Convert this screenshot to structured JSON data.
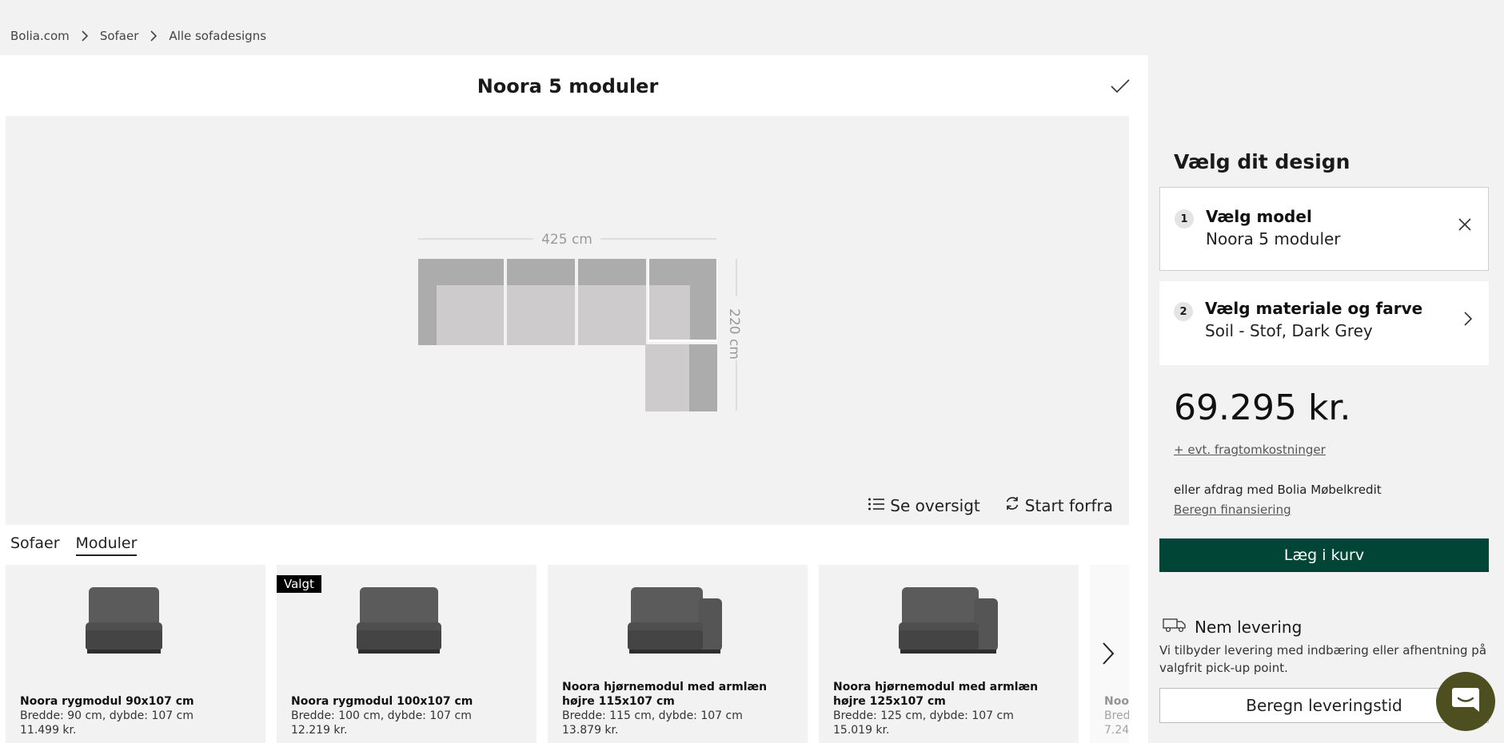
{
  "breadcrumb": [
    "Bolia.com",
    "Sofaer",
    "Alle sofadesigns"
  ],
  "configurator": {
    "title": "Noora 5 moduler",
    "dimension_width": "425 cm",
    "dimension_depth": "220 cm",
    "actions": {
      "overview": "Se oversigt",
      "restart": "Start forfra"
    }
  },
  "tabs": [
    "Sofaer",
    "Moduler"
  ],
  "active_tab": "Moduler",
  "modules": [
    {
      "name": "Noora rygmodul 90x107 cm",
      "dims": "Bredde: 90 cm, dybde: 107 cm",
      "price": "11.499 kr.",
      "badge": ""
    },
    {
      "name": "Noora rygmodul 100x107 cm",
      "dims": "Bredde: 100 cm, dybde: 107 cm",
      "price": "12.219 kr.",
      "badge": "Valgt"
    },
    {
      "name": "Noora hjørnemodul med armlæn højre 115x107 cm",
      "dims": "Bredde: 115 cm, dybde: 107 cm",
      "price": "13.879 kr.",
      "badge": ""
    },
    {
      "name": "Noora hjørnemodul med armlæn højre 125x107 cm",
      "dims": "Bredde: 125 cm, dybde: 107 cm",
      "price": "15.019 kr.",
      "badge": ""
    },
    {
      "name": "Noo",
      "dims": "Bred",
      "price": "7.24",
      "badge": ""
    }
  ],
  "sidebar": {
    "heading": "Vælg dit design",
    "step1": {
      "number": "1",
      "title": "Vælg model",
      "value": "Noora 5 moduler"
    },
    "step2": {
      "number": "2",
      "title": "Vælg materiale og farve",
      "value": "Soil - Stof, Dark Grey"
    },
    "price": "69.295 kr.",
    "freight_link": "+ evt. fragtomkostninger",
    "credit_text": "eller afdrag med Bolia Møbelkredit",
    "credit_link": "Beregn finansiering",
    "cart_button": "Læg i kurv",
    "delivery_title": "Nem levering",
    "delivery_text": "Vi tilbyder levering med indbæring eller afhentning på valgfrit pick-up point.",
    "delivery_button": "Beregn leveringstid"
  },
  "colors": {
    "accent": "#004536",
    "chat": "#4d4f21",
    "module_light": "#cdcbcb",
    "module_dark": "#acacac"
  },
  "icons": [
    "chevron-right-icon",
    "check-icon",
    "list-icon",
    "refresh-icon",
    "close-icon",
    "truck-icon",
    "chat-icon"
  ]
}
